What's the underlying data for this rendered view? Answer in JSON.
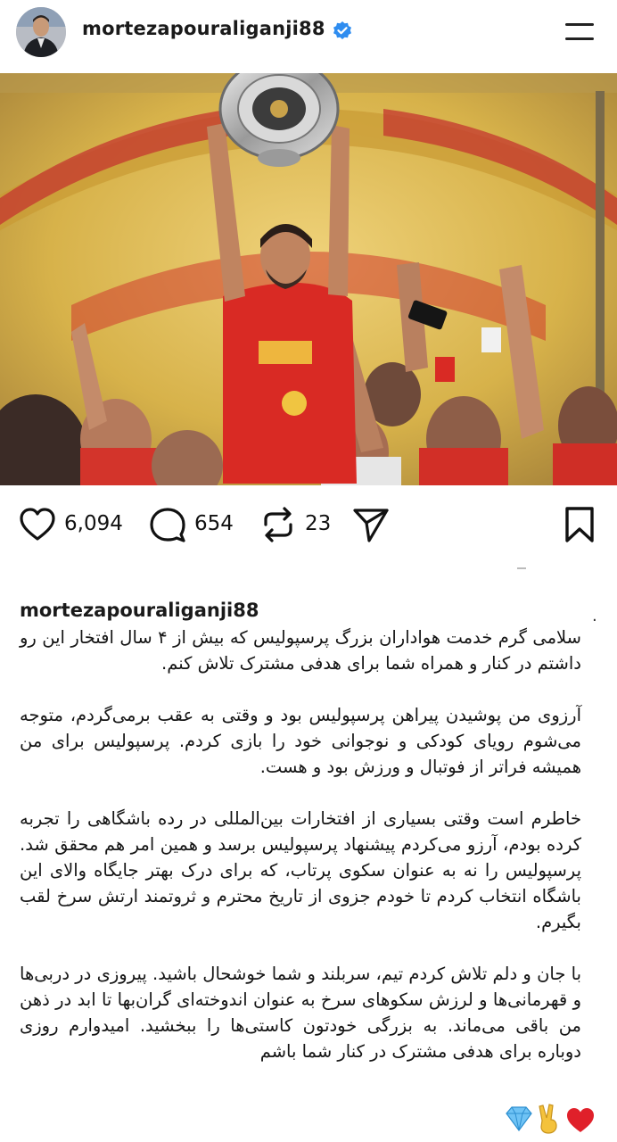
{
  "header": {
    "username": "mortezapouraliganji88",
    "verified": true,
    "menu_icon": "hamburger-icon"
  },
  "post": {
    "image_alt": "Player lifting the league trophy surrounded by teammates in red kits",
    "colors": {
      "kit_red": "#d92a24",
      "stage_gold": "#d7b24a",
      "verified_blue": "#2f8df0"
    }
  },
  "actions": {
    "likes": "6,094",
    "comments": "654",
    "reposts": "23"
  },
  "caption": {
    "username": "mortezapouraliganji88",
    "dot": ".",
    "paragraphs": [
      "سلامی گرم خدمت هواداران بزرگ پرسپولیس که بیش از ۴ سال افتخار این رو داشتم در کنار و همراه شما برای هدفی مشترک تلاش کنم.",
      "آرزوی من پوشیدن پیراهن پرسپولیس بود و وقتی به عقب برمی‌گردم، متوجه می‌شوم رویای کودکی و نوجوانی خود را بازی کردم. پرسپولیس برای من همیشه فراتر از فوتبال و ورزش بود و هست.",
      "خاطرم است وقتی بسیاری از افتخارات بین‌المللی در رده باشگاهی را تجربه کرده بودم، آرزو می‌کردم پیشنهاد پرسپولیس برسد و همین امر هم محقق شد. پرسپولیس را نه به عنوان سکوی پرتاب، که برای درک بهتر جایگاه والای این باشگاه انتخاب کردم تا خودم جزوی از تاریخ محترم و ثروتمند ارتش سرخ لقب بگیرم.",
      "با جان و دلم تلاش کردم تیم، سربلند و شما خوشحال باشید. پیروزی در دربی‌ها و قهرمانی‌ها و لرزش سکوهای سرخ به عنوان اندوخته‌ای گران‌بها تا ابد در ذهن من باقی می‌ماند. به بزرگی خودتون کاستی‌ها را ببخشید. امیدوارم روزی دوباره برای هدفی مشترک در کنار شما باشم"
    ],
    "emojis": [
      "heart-icon",
      "victory-hand-icon",
      "diamond-icon"
    ]
  }
}
